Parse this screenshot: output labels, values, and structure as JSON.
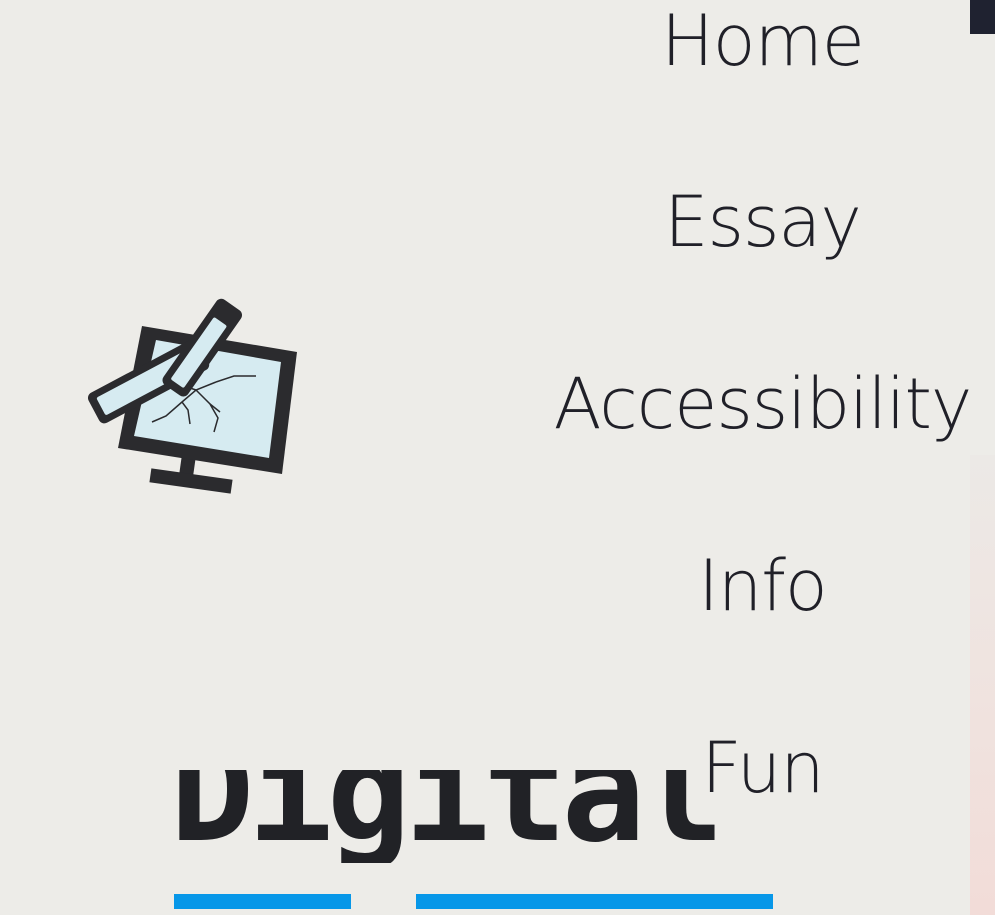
{
  "logo": {
    "icon": "broken-computer-hammer-icon"
  },
  "nav": {
    "items": [
      {
        "label": "Home"
      },
      {
        "label": "Essay"
      },
      {
        "label": "Accessibility"
      },
      {
        "label": "Info"
      },
      {
        "label": "Fun"
      }
    ]
  },
  "heading": {
    "text": "Digital"
  },
  "colors": {
    "background": "#edece8",
    "text": "#202028",
    "accent_underline": "#0797e8",
    "logo_screen": "#d6ebf1",
    "logo_outline": "#2b2b2e"
  }
}
